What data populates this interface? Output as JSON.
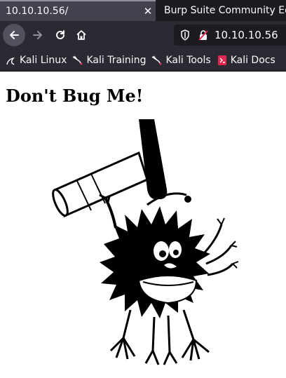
{
  "tabs": [
    {
      "label": "10.10.10.56/",
      "active": true
    },
    {
      "label": "Burp Suite Community Edit",
      "active": false
    }
  ],
  "nav": {
    "url": "10.10.10.56"
  },
  "bookmarks": [
    {
      "label": "Kali Linux"
    },
    {
      "label": "Kali Training"
    },
    {
      "label": "Kali Tools"
    },
    {
      "label": "Kali Docs"
    }
  ],
  "page": {
    "heading": "Don't Bug Me!"
  },
  "colors": {
    "tab_strip": "#1c1b22",
    "active_tab": "#42414d",
    "toolbar": "#2b2a33",
    "urlbar": "#1c1b22",
    "text_light": "#fbfbfe",
    "page_bg": "#ffffff"
  }
}
